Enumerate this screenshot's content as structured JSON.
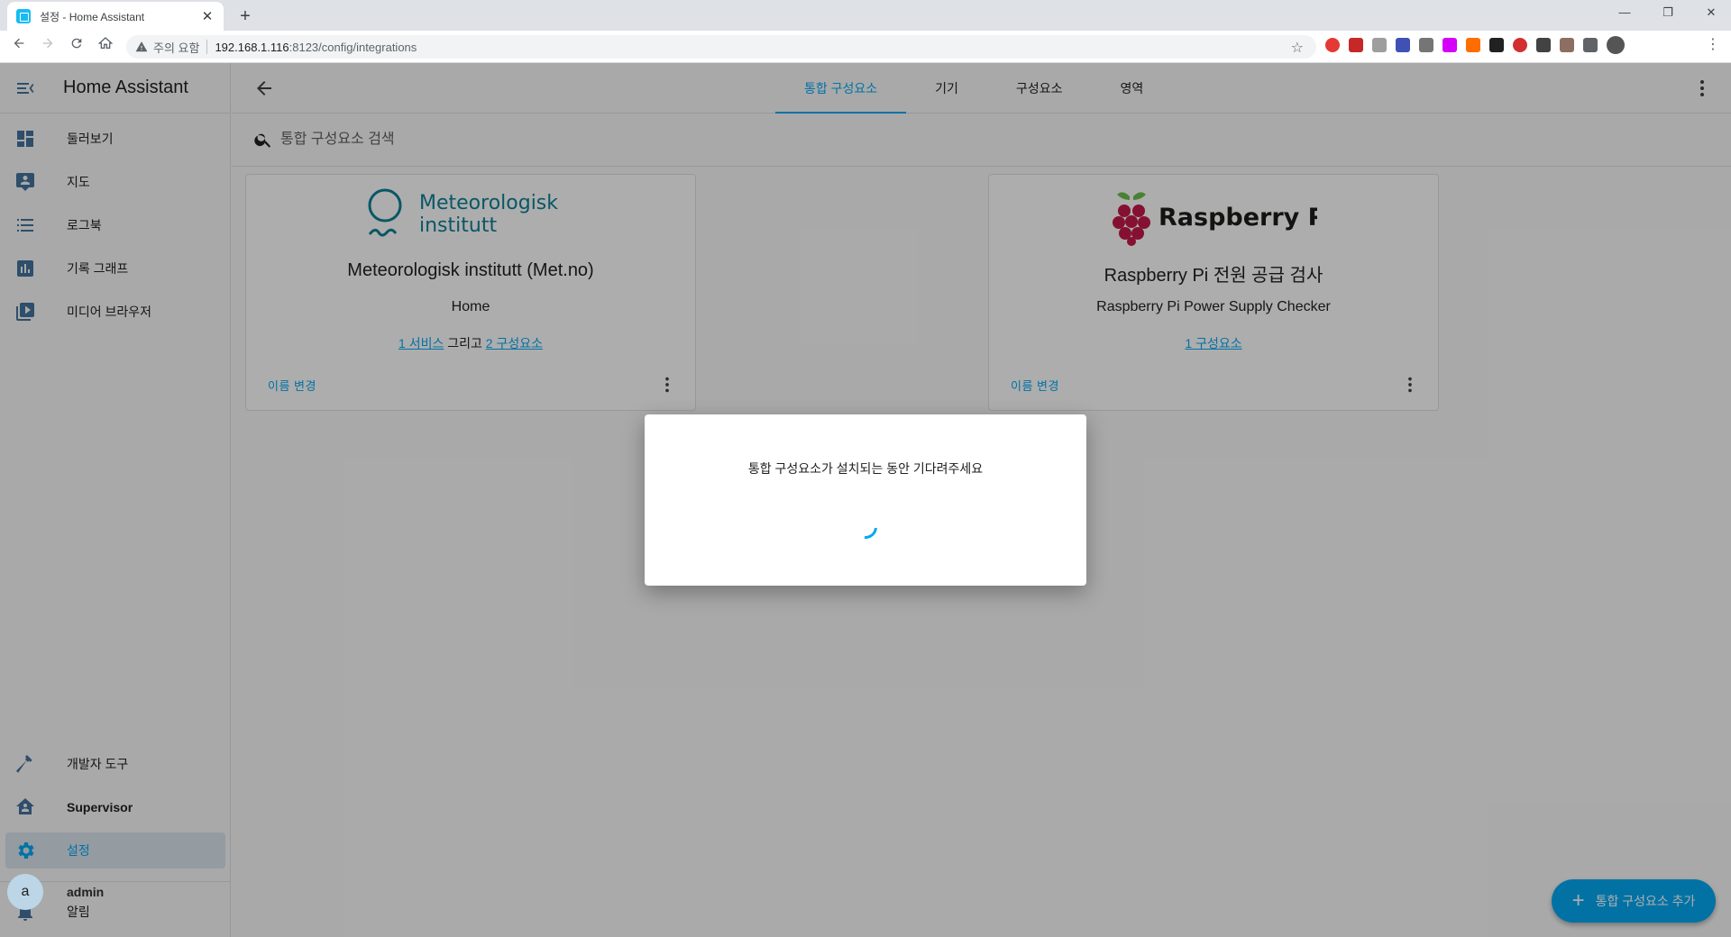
{
  "browser": {
    "tab_title": "설정 - Home Assistant",
    "tab_close": "✕",
    "new_tab": "+",
    "security_label": "주의 요함",
    "url_host": "192.168.1.116",
    "url_path": ":8123/config/integrations",
    "window_controls": [
      "—",
      "❐",
      "✕"
    ]
  },
  "sidebar": {
    "title": "Home Assistant",
    "items": [
      {
        "label": "둘러보기",
        "icon": "dashboard-icon"
      },
      {
        "label": "지도",
        "icon": "map-icon"
      },
      {
        "label": "로그북",
        "icon": "logbook-icon"
      },
      {
        "label": "기록 그래프",
        "icon": "history-icon"
      },
      {
        "label": "미디어 브라우저",
        "icon": "media-icon"
      }
    ],
    "bottom_items": [
      {
        "label": "개발자 도구",
        "icon": "hammer-icon"
      },
      {
        "label": "Supervisor",
        "icon": "supervisor-icon"
      },
      {
        "label": "설정",
        "icon": "gear-icon",
        "active": true
      }
    ],
    "notifications_label": "알림",
    "user": {
      "initial": "a",
      "name": "admin"
    }
  },
  "topbar": {
    "tabs": [
      "통합 구성요소",
      "기기",
      "구성요소",
      "영역"
    ],
    "active_tab": 0
  },
  "search": {
    "placeholder": "통합 구성요소 검색"
  },
  "cards": [
    {
      "logo_line1": "Meteorologisk",
      "logo_line2": "institutt",
      "name": "Meteorologisk institutt (Met.no)",
      "entry": "Home",
      "link1": "1 서비스",
      "joiner": "그리고",
      "link2": "2 구성요소",
      "rename": "이름 변경"
    },
    {
      "logo_text": "Raspberry Pi",
      "name_en": "Raspberry Pi",
      "name_ko": "전원 공급 검사",
      "entry": "Raspberry Pi Power Supply Checker",
      "link1": "1 구성요소",
      "rename": "이름 변경"
    }
  ],
  "fab": {
    "label": "통합 구성요소 추가"
  },
  "dialog": {
    "text": "통합 구성요소가 설치되는 동안 기다려주세요"
  },
  "colors": {
    "primary": "#03a9f4",
    "sidebar_icon": "#44739e",
    "active_bg": "#dbe5ee"
  }
}
